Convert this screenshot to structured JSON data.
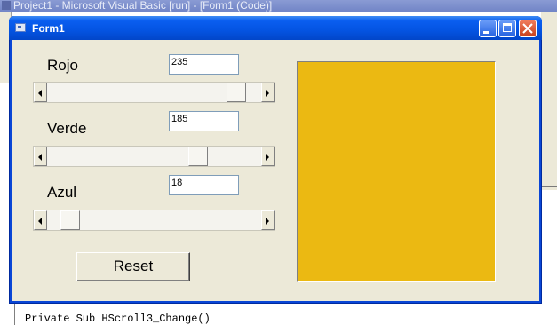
{
  "ide": {
    "title": "Project1 - Microsoft Visual Basic [run] - [Form1 (Code)]",
    "code_line": "Private Sub HScroll3_Change()"
  },
  "form": {
    "title": "Form1",
    "labels": {
      "red": "Rojo",
      "green": "Verde",
      "blue": "Azul"
    },
    "values": {
      "red": "235",
      "green": "185",
      "blue": "18"
    },
    "scroll_levels": {
      "red": 235,
      "green": 185,
      "blue": 18,
      "max": 255
    },
    "reset_label": "Reset",
    "preview_color": "#EBB912"
  },
  "icons": {
    "scroll_left": "left-arrow-icon",
    "scroll_right": "right-arrow-icon",
    "close": "close-icon",
    "minimize": "minimize-icon",
    "maximize": "maximize-icon",
    "form": "form-icon"
  }
}
